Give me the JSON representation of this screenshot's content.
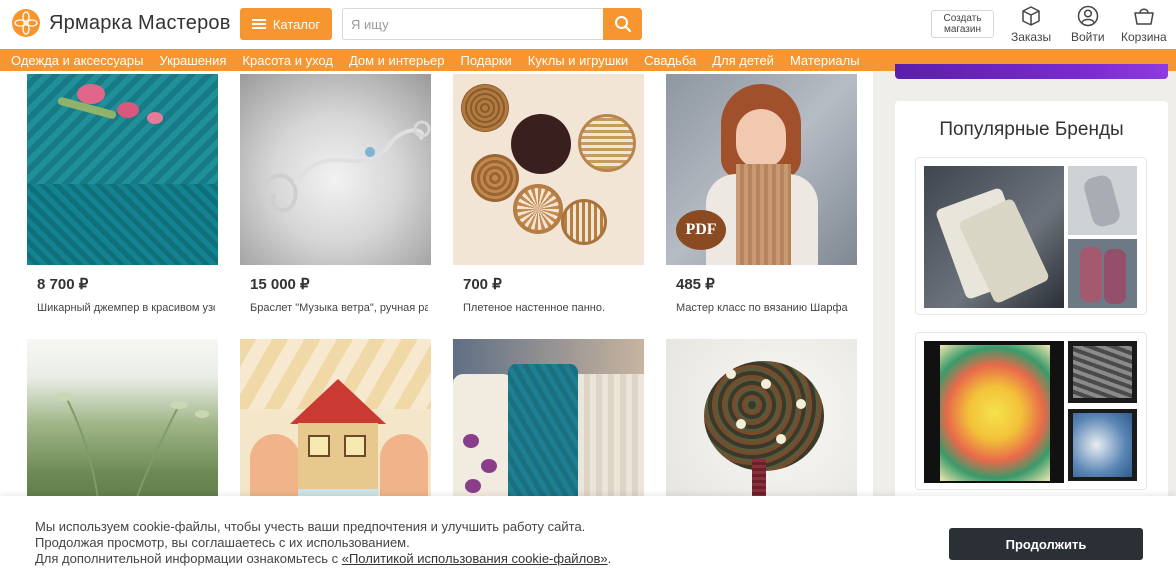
{
  "header": {
    "logo_text": "Ярмарка Мастеров",
    "catalog_label": "Каталог",
    "search_placeholder": "Я ищу",
    "create_shop_line1": "Создать",
    "create_shop_line2": "магазин",
    "orders_label": "Заказы",
    "login_label": "Войти",
    "cart_label": "Корзина"
  },
  "nav": {
    "items": [
      "Одежда и аксессуары",
      "Украшения",
      "Красота и уход",
      "Дом и интерьер",
      "Подарки",
      "Куклы и игрушки",
      "Свадьба",
      "Для детей",
      "Материалы"
    ]
  },
  "products": [
    {
      "price": "8 700 ₽",
      "title": "Шикарный джемпер в красивом узоре"
    },
    {
      "price": "15 000 ₽",
      "title": "Браслет \"Музыка ветра\", ручная работа"
    },
    {
      "price": "700 ₽",
      "title": "Плетеное настенное панно."
    },
    {
      "price": "485 ₽",
      "title": "Мастер класс по вязанию Шарфа"
    },
    {
      "price": "",
      "title": ""
    },
    {
      "price": "",
      "title": ""
    },
    {
      "price": "",
      "title": ""
    },
    {
      "price": "",
      "title": ""
    }
  ],
  "pdf_badge": "PDF",
  "sidebar": {
    "brands_title": "Популярные Бренды"
  },
  "cookie": {
    "line1": "Мы используем cookie-файлы, чтобы учесть ваши предпочтения и улучшить работу сайта.",
    "line2": "Продолжая просмотр, вы соглашаетесь с их использованием.",
    "line3_prefix": "Для дополнительной информации ознакомьтесь с ",
    "link_text": "«Политикой использования cookie-файлов»",
    "line3_suffix": ".",
    "continue_label": "Продолжить"
  },
  "colors": {
    "accent": "#f79530",
    "dark_button": "#2b2f36",
    "banner_purple": "#6a24be"
  }
}
